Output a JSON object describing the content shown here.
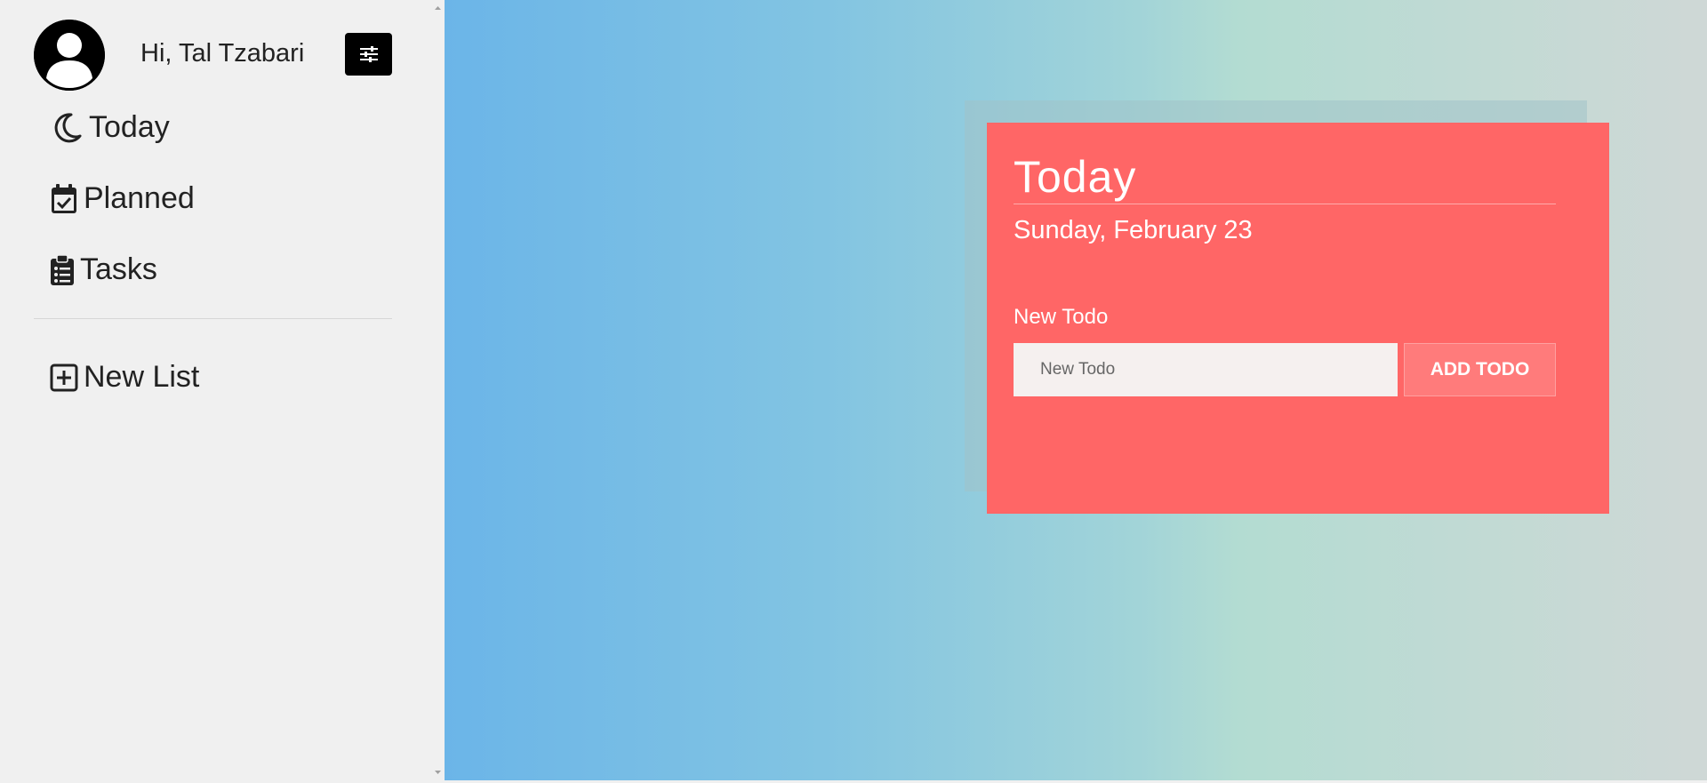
{
  "sidebar": {
    "greeting": "Hi, Tal Tzabari",
    "avatar_icon": "user-avatar-icon",
    "settings_icon": "sliders-icon",
    "nav_items": [
      {
        "label": "Today",
        "icon": "moon-icon"
      },
      {
        "label": "Planned",
        "icon": "calendar-check-icon"
      },
      {
        "label": "Tasks",
        "icon": "clipboard-list-icon"
      }
    ],
    "new_list": {
      "label": "New List",
      "icon": "plus-square-icon"
    }
  },
  "card": {
    "title": "Today",
    "date": "Sunday, February 23",
    "todo_label": "New Todo",
    "input_placeholder": "New Todo",
    "input_value": "",
    "add_button_label": "ADD TODO",
    "background_color": "#ff6666"
  }
}
